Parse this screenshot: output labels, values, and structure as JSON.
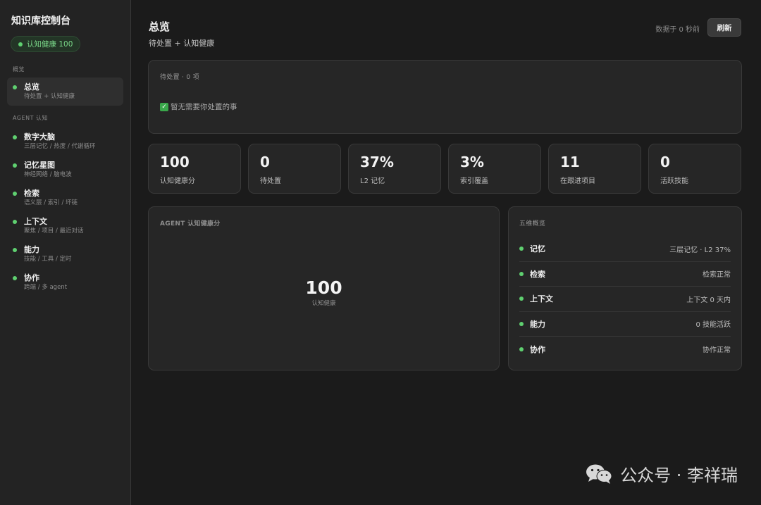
{
  "sidebar": {
    "title": "知识库控制台",
    "health_badge": "认知健康 100",
    "section_overview": "概览",
    "section_agent": "AGENT 认知",
    "overview_item": {
      "title": "总览",
      "sub": "待处置 + 认知健康"
    },
    "items": [
      {
        "title": "数字大脑",
        "sub": "三层记忆 / 热度 / 代谢循环"
      },
      {
        "title": "记忆星图",
        "sub": "神经网络 / 脑电波"
      },
      {
        "title": "检索",
        "sub": "语义层 / 索引 / 坏链"
      },
      {
        "title": "上下文",
        "sub": "聚焦 / 项目 / 最近对话"
      },
      {
        "title": "能力",
        "sub": "技能 / 工具 / 定时"
      },
      {
        "title": "协作",
        "sub": "跨端 / 多 agent"
      }
    ]
  },
  "header": {
    "title": "总览",
    "subtitle": "待处置 + 认知健康",
    "updated": "数据于 0 秒前",
    "refresh_label": "刷新"
  },
  "pending": {
    "label": "待处置 · 0 项",
    "empty_text": "暂无需要你处置的事"
  },
  "stats": [
    {
      "value": "100",
      "label": "认知健康分"
    },
    {
      "value": "0",
      "label": "待处置"
    },
    {
      "value": "37%",
      "label": "L2 记忆"
    },
    {
      "value": "3%",
      "label": "索引覆盖"
    },
    {
      "value": "11",
      "label": "在跟进项目"
    },
    {
      "value": "0",
      "label": "活跃技能"
    }
  ],
  "health": {
    "label": "AGENT 认知健康分",
    "score": "100",
    "caption": "认知健康"
  },
  "dimensions": {
    "label": "五维概览",
    "rows": [
      {
        "name": "记忆",
        "value": "三层记忆 · L2 37%"
      },
      {
        "name": "检索",
        "value": "检索正常"
      },
      {
        "name": "上下文",
        "value": "上下文 0 天内"
      },
      {
        "name": "能力",
        "value": "0 技能活跃"
      },
      {
        "name": "协作",
        "value": "协作正常"
      }
    ]
  },
  "watermark": "公众号 · 李祥瑞",
  "colors": {
    "status_green": "#5fd070",
    "background": "#1b1b1b",
    "card": "#262626"
  }
}
